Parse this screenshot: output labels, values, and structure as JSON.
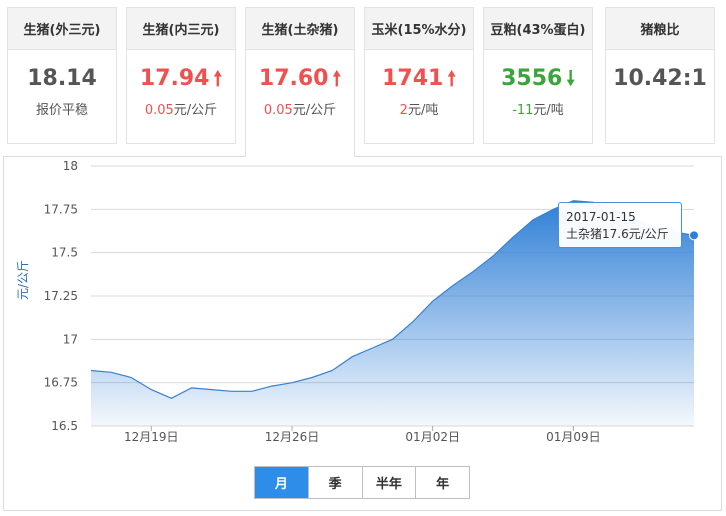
{
  "cards": [
    {
      "title": "生猪(外三元)",
      "value": "18.14",
      "trend": "none",
      "sub": "报价平稳"
    },
    {
      "title": "生猪(内三元)",
      "value": "17.94",
      "trend": "up",
      "sub_value": "0.05",
      "sub_unit": "元/公斤"
    },
    {
      "title": "生猪(土杂猪)",
      "value": "17.60",
      "trend": "up",
      "sub_value": "0.05",
      "sub_unit": "元/公斤"
    },
    {
      "title": "玉米(15%水分)",
      "value": "1741",
      "trend": "up",
      "sub_value": "2",
      "sub_unit": "元/吨"
    },
    {
      "title": "豆粕(43%蛋白)",
      "value": "3556",
      "trend": "down",
      "sub_value": "-11",
      "sub_unit": "元/吨"
    },
    {
      "title": "猪粮比",
      "value": "10.42:1",
      "trend": "none",
      "sub": ""
    }
  ],
  "colors": {
    "up": "#f05050",
    "down": "#3aa53a",
    "accent": "#2e8de8",
    "series": "#3f86d4"
  },
  "icons": {
    "up": "arrow-up-icon",
    "down": "arrow-down-icon"
  },
  "tooltip": {
    "date": "2017-01-15",
    "series": "土杂猪",
    "value": "17.6",
    "unit": "元/公斤"
  },
  "range_buttons": [
    {
      "label": "月",
      "active": true
    },
    {
      "label": "季",
      "active": false
    },
    {
      "label": "半年",
      "active": false
    },
    {
      "label": "年",
      "active": false
    }
  ],
  "chart_data": {
    "type": "area",
    "ylabel": "元/公斤",
    "ylim": [
      16.5,
      18
    ],
    "yticks": [
      "16.5",
      "16.75",
      "17",
      "17.25",
      "17.5",
      "17.75",
      "18"
    ],
    "xticks": [
      {
        "label": "12月19日",
        "x": 3
      },
      {
        "label": "12月26日",
        "x": 10
      },
      {
        "label": "01月02日",
        "x": 17
      },
      {
        "label": "01月09日",
        "x": 24
      }
    ],
    "grid": true,
    "series": [
      {
        "name": "土杂猪",
        "x": [
          0,
          1,
          2,
          3,
          4,
          5,
          6,
          7,
          8,
          9,
          10,
          11,
          12,
          13,
          14,
          15,
          16,
          17,
          18,
          19,
          20,
          21,
          22,
          23,
          24,
          25,
          26,
          27,
          28,
          29,
          30
        ],
        "values": [
          16.82,
          16.81,
          16.78,
          16.71,
          16.66,
          16.72,
          16.71,
          16.7,
          16.7,
          16.73,
          16.75,
          16.78,
          16.82,
          16.9,
          16.95,
          17.0,
          17.1,
          17.22,
          17.31,
          17.39,
          17.48,
          17.59,
          17.69,
          17.75,
          17.8,
          17.79,
          17.75,
          17.7,
          17.65,
          17.62,
          17.6
        ]
      }
    ]
  }
}
